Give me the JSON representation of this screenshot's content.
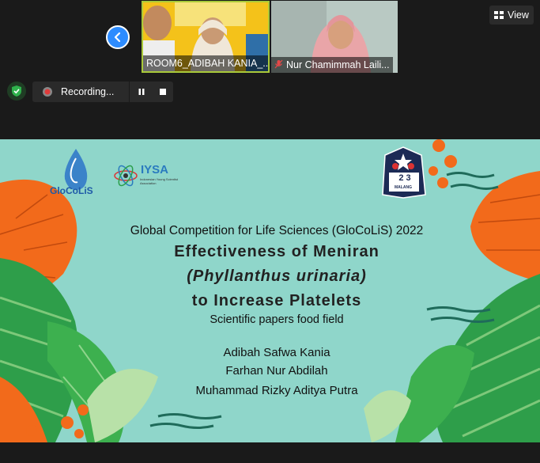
{
  "meeting": {
    "view_label": "View",
    "recording_label": "Recording...",
    "participants": [
      {
        "name": "ROOM6_ADIBAH KANIA_..."
      },
      {
        "name": "Nur Chamimmah Laili..."
      }
    ]
  },
  "slide": {
    "logos": {
      "glocolis": "GloCoLiS",
      "iysa": "IYSA",
      "iysa_sub": "Indonesian Young Scientist Association",
      "school_numbers": "2 3",
      "school_city": "MALANG"
    },
    "competition": "Global Competition for Life Sciences (GloCoLiS) 2022",
    "title_line1": "Effectiveness of Meniran",
    "title_line2": "(Phyllanthus urinaria)",
    "title_line3": "to Increase Platelets",
    "subtitle": "Scientific papers food field",
    "authors": [
      "Adibah Safwa Kania",
      "Farhan Nur Abdilah",
      "Muhammad Rizky Aditya Putra"
    ]
  },
  "colors": {
    "accent": "#2d8cff",
    "slide_bg": "#8fd6ca",
    "active_speaker": "#a9c93a",
    "leaf_orange": "#f26a1b",
    "leaf_green": "#2e9e4a"
  }
}
